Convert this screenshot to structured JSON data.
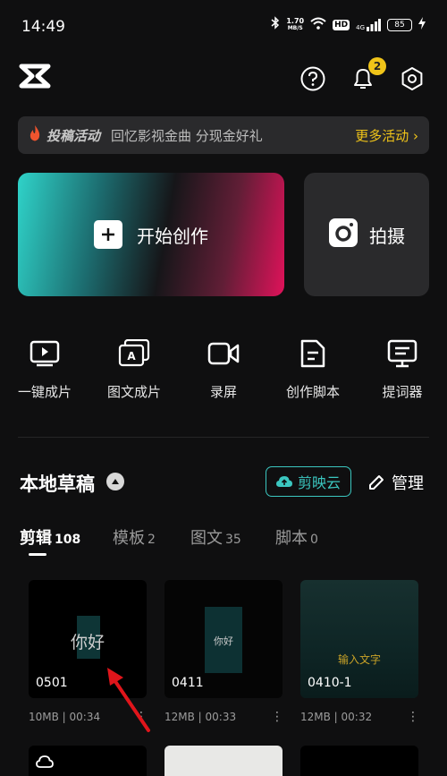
{
  "status_bar": {
    "time": "14:49",
    "net_speed_value": "1.70",
    "net_speed_unit": "MB/S",
    "hd_label": "HD",
    "signal_label": "4G",
    "battery": "85"
  },
  "header": {
    "notification_count": "2"
  },
  "banner": {
    "tag": "投稿活动",
    "text": "回忆影视金曲 分现金好礼",
    "more": "更多活动 ›"
  },
  "actions": {
    "create_label": "开始创作",
    "shoot_label": "拍摄"
  },
  "tools": [
    {
      "label": "一键成片",
      "icon": "play-video-icon"
    },
    {
      "label": "图文成片",
      "icon": "text-image-icon"
    },
    {
      "label": "录屏",
      "icon": "screen-record-icon"
    },
    {
      "label": "创作脚本",
      "icon": "script-doc-icon"
    },
    {
      "label": "提词器",
      "icon": "teleprompter-icon"
    }
  ],
  "drafts": {
    "title": "本地草稿",
    "cloud_label": "剪映云",
    "manage_label": "管理",
    "tabs": [
      {
        "label": "剪辑",
        "count": "108"
      },
      {
        "label": "模板",
        "count": "2"
      },
      {
        "label": "图文",
        "count": "35"
      },
      {
        "label": "脚本",
        "count": "0"
      }
    ],
    "items": [
      {
        "name": "0501",
        "size": "10MB",
        "duration": "00:34",
        "thumb_text": "你好"
      },
      {
        "name": "0411",
        "size": "12MB",
        "duration": "00:33",
        "thumb_text": "你好"
      },
      {
        "name": "0410-1",
        "size": "12MB",
        "duration": "00:32",
        "thumb_text": "输入文字"
      }
    ]
  },
  "colors": {
    "accent_teal": "#3bc7c0",
    "accent_yellow": "#f0c419",
    "annotation_arrow": "#e0151b"
  }
}
